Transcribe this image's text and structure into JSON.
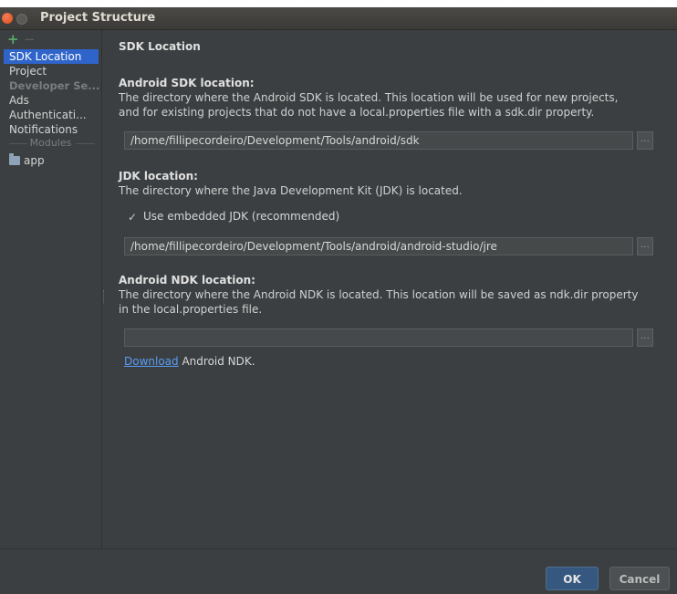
{
  "window": {
    "title": "Project Structure"
  },
  "sidebar": {
    "toolbar": {
      "add": "+",
      "remove": "−"
    },
    "items": [
      {
        "label": "SDK Location",
        "selected": true
      },
      {
        "label": "Project"
      },
      {
        "label": "Developer Se...",
        "section": true
      },
      {
        "label": "Ads"
      },
      {
        "label": "Authenticati..."
      },
      {
        "label": "Notifications"
      }
    ],
    "modules_label": "Modules",
    "modules": [
      {
        "label": "app"
      }
    ]
  },
  "main": {
    "section_title": "SDK Location",
    "android_sdk": {
      "heading": "Android SDK location:",
      "description_line1": "The directory where the Android SDK is located. This location will be used for new projects,",
      "description_line2": "and for existing projects that do not have a local.properties file with a sdk.dir property.",
      "path": "/home/fillipecordeiro/Development/Tools/android/sdk"
    },
    "jdk": {
      "heading": "JDK location:",
      "description": "The directory where the Java Development Kit (JDK) is located.",
      "checkbox_label": "Use embedded JDK (recommended)",
      "checkbox_checked": true,
      "path": "/home/fillipecordeiro/Development/Tools/android/android-studio/jre"
    },
    "ndk": {
      "heading": "Android NDK location:",
      "description_line1": "The directory where the Android NDK is located. This location will be saved as ndk.dir property",
      "description_line2": "in the local.properties file.",
      "path": "",
      "download_link": "Download",
      "download_suffix": " Android NDK."
    },
    "browse_label": "..."
  },
  "buttons": {
    "ok": "OK",
    "cancel": "Cancel"
  },
  "colors": {
    "background": "#3c3f41",
    "selection": "#2f65ca",
    "link": "#589df6",
    "ok_button": "#365880"
  }
}
